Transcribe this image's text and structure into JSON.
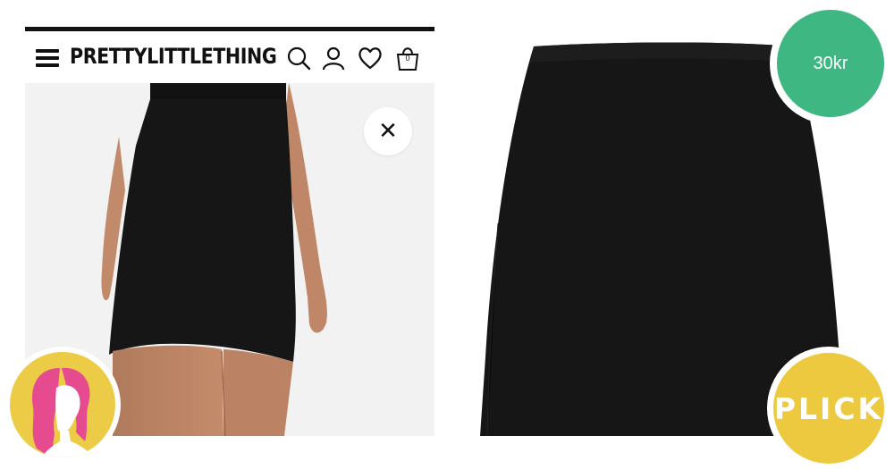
{
  "store": {
    "brand": "PRETTYLITTLETHING",
    "bag_count": "0",
    "icons": [
      "menu-icon",
      "search-icon",
      "account-icon",
      "heart-icon",
      "bag-icon"
    ]
  },
  "listing": {
    "price": "30kr",
    "action_label": "PLICK"
  },
  "colors": {
    "price_badge": "#3fb783",
    "plick_badge": "#ecc93f",
    "avatar_badge": "#eccb47",
    "skirt": "#161616"
  }
}
